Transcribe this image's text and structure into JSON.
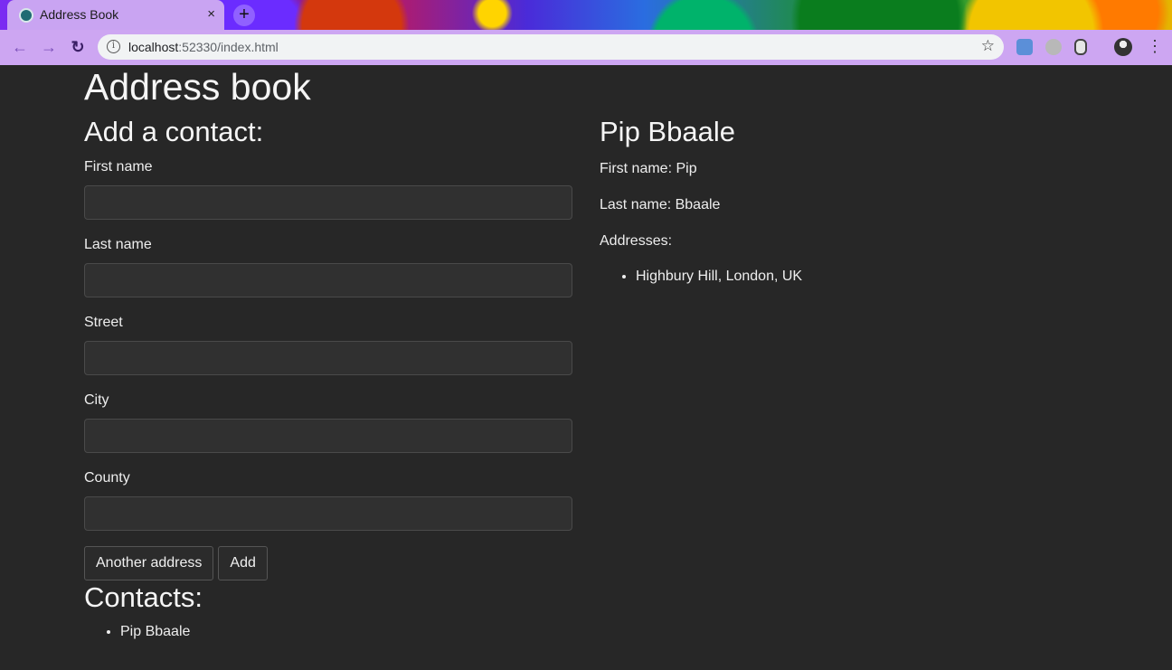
{
  "browser": {
    "tab_title": "Address Book",
    "tab_close": "×",
    "new_tab": "+",
    "url_host": "localhost",
    "url_rest": ":52330/index.html",
    "icons": [
      "back-arrow-icon",
      "forward-arrow-icon",
      "reload-icon",
      "info-icon",
      "star-icon",
      "menu-icon"
    ]
  },
  "page": {
    "title": "Address book",
    "form": {
      "heading": "Add a contact:",
      "fields": [
        {
          "label": "First name",
          "value": "",
          "placeholder": ""
        },
        {
          "label": "Last name",
          "value": "",
          "placeholder": ""
        },
        {
          "label": "Street",
          "value": "",
          "placeholder": ""
        },
        {
          "label": "City",
          "value": "",
          "placeholder": ""
        },
        {
          "label": "County",
          "value": "",
          "placeholder": ""
        }
      ],
      "another_address_label": "Another address",
      "add_label": "Add"
    },
    "contacts": {
      "heading": "Contacts:",
      "items": [
        "Pip Bbaale"
      ]
    },
    "detail": {
      "heading": "Pip Bbaale",
      "first_name": "First name: Pip",
      "last_name": "Last name: Bbaale",
      "addresses_label": "Addresses:",
      "addresses": [
        "Highbury Hill, London, UK"
      ]
    }
  },
  "colors": {
    "background": "#272727",
    "input_background": "#303030",
    "text": "#f2f2f2"
  }
}
